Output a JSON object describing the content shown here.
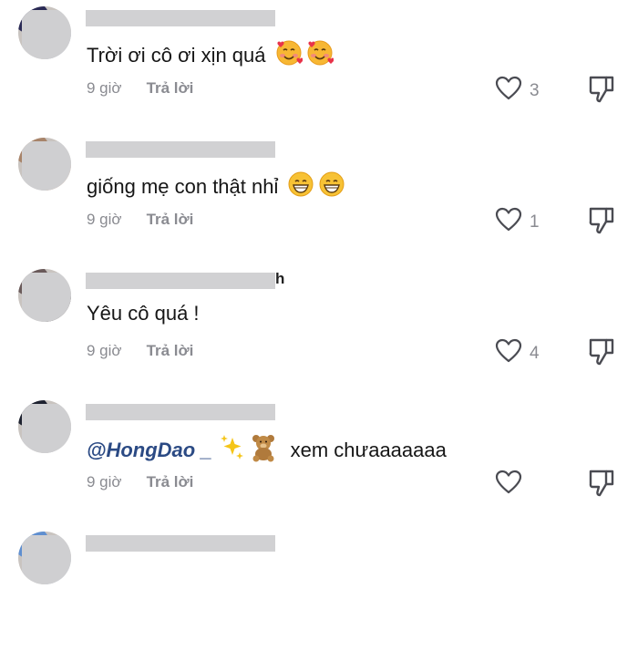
{
  "comments": [
    {
      "name_suffix": "",
      "text": "Trời ơi cô ơi xịn quá",
      "emojis": [
        "smiling-face-with-hearts",
        "smiling-face-with-hearts"
      ],
      "time": "9 giờ",
      "reply_label": "Trả lời",
      "likes": "3",
      "avatar_colors": [
        "#2a2a55",
        "#b8c2d8"
      ]
    },
    {
      "name_suffix": "",
      "text": "giống mẹ con thật nhỉ",
      "emojis": [
        "grinning-face",
        "grinning-face"
      ],
      "time": "9 giờ",
      "reply_label": "Trả lời",
      "likes": "1",
      "avatar_colors": [
        "#a8846a",
        "#e8b79a"
      ]
    },
    {
      "name_suffix": "h",
      "text": "Yêu cô quá !",
      "emojis": [],
      "time": "9 giờ",
      "reply_label": "Trả lời",
      "likes": "4",
      "avatar_colors": [
        "#6a5a5a",
        "#3a2e30"
      ]
    },
    {
      "name_suffix": "",
      "mention": "@HongDao _",
      "text": "xem chưaaaaaaa",
      "emojis": [
        "sparkles",
        "teddy-bear"
      ],
      "time": "9 giờ",
      "reply_label": "Trả lời",
      "likes": "",
      "avatar_colors": [
        "#1e2230",
        "#c8c8cc"
      ]
    },
    {
      "name_suffix": "",
      "text": "",
      "emojis": [],
      "time": "",
      "reply_label": "",
      "likes": "",
      "avatar_colors": [
        "#5f8fd0",
        "#c8d6ea"
      ]
    }
  ],
  "colors": {
    "text": "#161616",
    "meta": "#8a8b91",
    "mention": "#2b4a84",
    "redaction": "#d1d1d3",
    "background": "#ffffff"
  }
}
